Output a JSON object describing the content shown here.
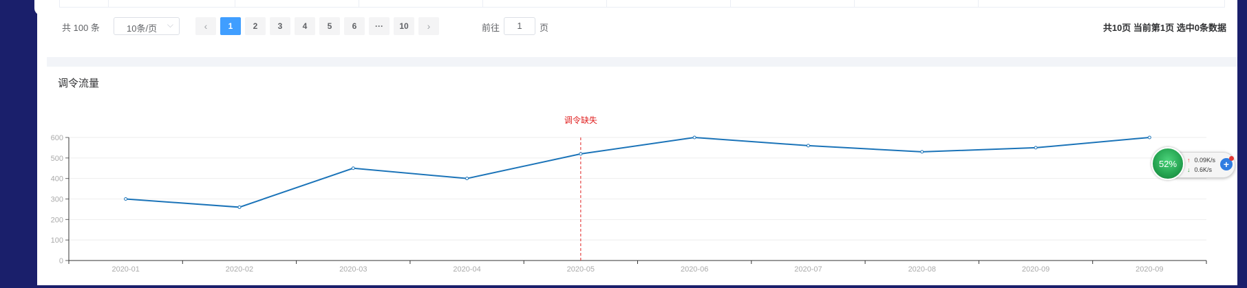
{
  "pagination": {
    "total_text": "共 100 条",
    "page_size": "10条/页",
    "prev_icon": "chevron-left-icon",
    "next_icon": "chevron-right-icon",
    "pages": [
      "1",
      "2",
      "3",
      "4",
      "5",
      "6",
      "···",
      "10"
    ],
    "active_page": "1",
    "goto_label": "前往",
    "goto_value": "1",
    "page_unit": "页",
    "summary": "共10页 当前第1页 选中0条数据"
  },
  "section": {
    "title": "调令流量"
  },
  "chart_data": {
    "type": "line",
    "title": "",
    "xlabel": "",
    "ylabel": "",
    "categories": [
      "2020-01",
      "2020-02",
      "2020-03",
      "2020-04",
      "2020-05",
      "2020-06",
      "2020-07",
      "2020-08",
      "2020-09",
      "2020-09"
    ],
    "series": [
      {
        "values": [
          300,
          260,
          450,
          400,
          520,
          600,
          560,
          530,
          550,
          600
        ]
      }
    ],
    "yticks": [
      0,
      100,
      200,
      300,
      400,
      500,
      600
    ],
    "ylim": [
      0,
      600
    ],
    "grid": true,
    "annotation": {
      "label": "调令缺失",
      "at_category": "2020-05",
      "style": "dashed",
      "color": "#e02020"
    },
    "line_color": "#1a73b8"
  },
  "float_widget": {
    "percent": "52%",
    "upload": "0.09K/s",
    "download": "0.6K/s",
    "upload_icon": "arrow-up-icon",
    "download_icon": "arrow-down-icon",
    "add_icon": "plus-icon"
  },
  "colors": {
    "sidebar": "#1a1f6b",
    "accent": "#409eff",
    "line": "#1a73b8",
    "annotation": "#e02020"
  }
}
